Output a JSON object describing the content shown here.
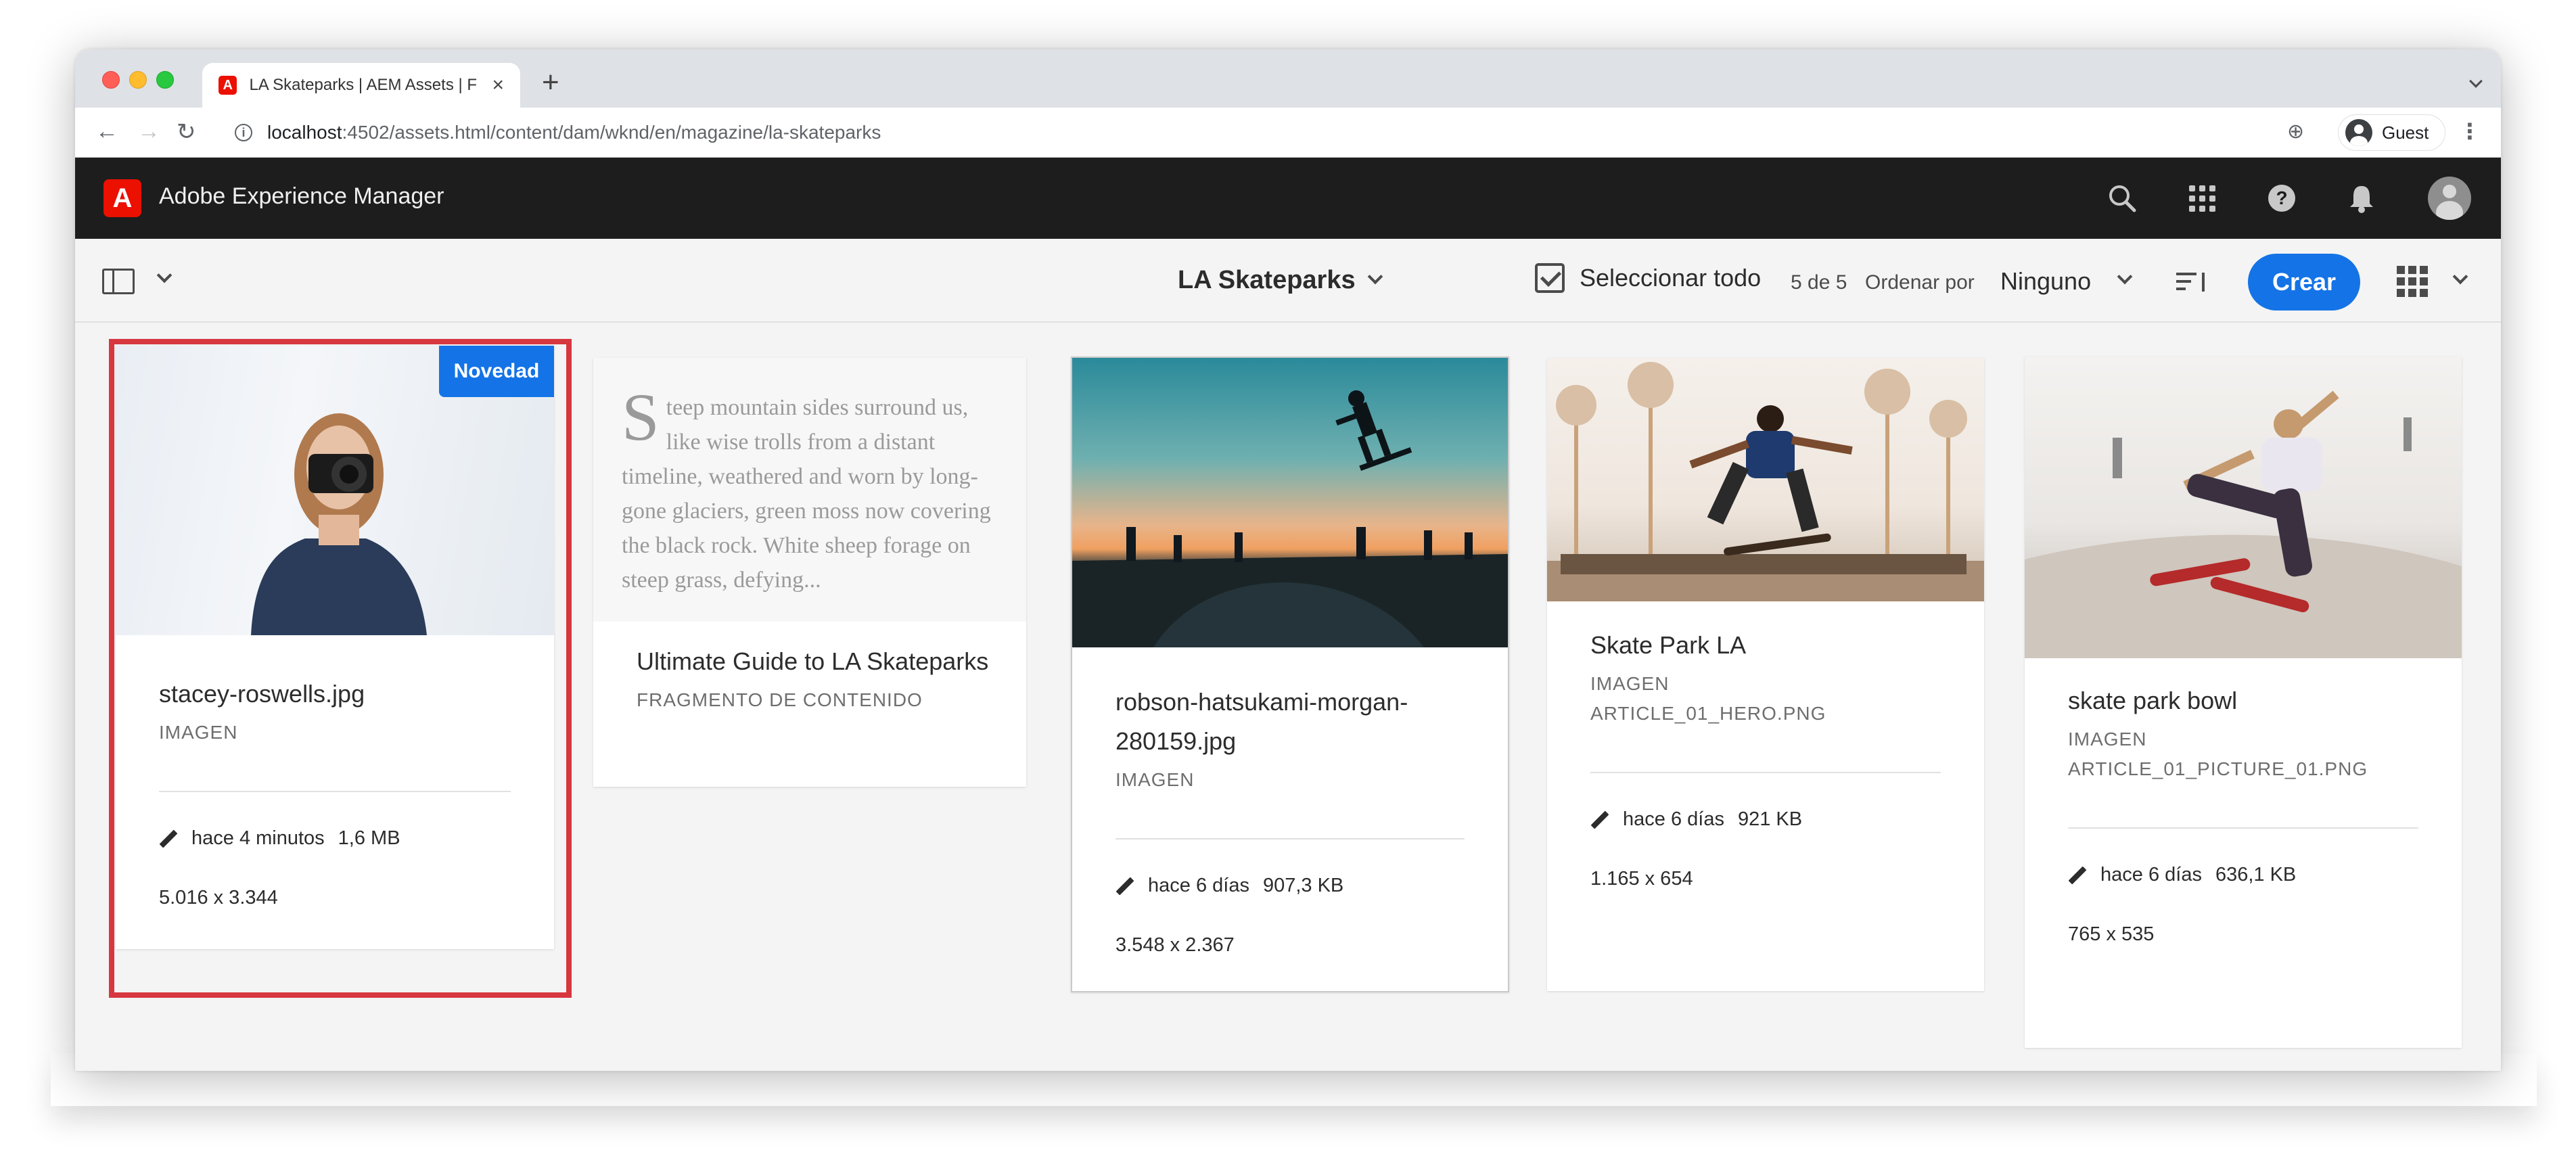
{
  "browser": {
    "tab_title": "LA Skateparks | AEM Assets | F",
    "url_host": "localhost",
    "url_path": ":4502/assets.html/content/dam/wknd/en/magazine/la-skateparks",
    "profile_label": "Guest"
  },
  "shell": {
    "app_title": "Adobe Experience Manager",
    "logo_glyph": "A",
    "icons": [
      "search-icon",
      "apps-icon",
      "help-icon",
      "bell-icon",
      "avatar"
    ]
  },
  "actionbar": {
    "folder_title": "LA Skateparks",
    "select_all_label": "Seleccionar todo",
    "count": "5 de 5",
    "sort_label": "Ordenar por",
    "sort_value": "Ninguno",
    "create_label": "Crear"
  },
  "colors": {
    "accent": "#1473e6",
    "adobe_red": "#eb1000",
    "selection_outline": "#d7373f"
  },
  "cards": [
    {
      "title": "stacey-roswells.jpg",
      "type": "IMAGEN",
      "badge": "Novedad",
      "modified": "hace 4 minutos",
      "size": "1,6 MB",
      "dimensions": "5.016 x 3.344"
    },
    {
      "preview_dropcap": "S",
      "preview_text": "teep mountain sides surround us, like wise trolls from a distant timeline, weathered and worn by long-gone glaciers, green moss now covering the black rock. White sheep forage on steep grass, defying...",
      "title": "Ultimate Guide to LA Skateparks",
      "type": "FRAGMENTO DE CONTENIDO"
    },
    {
      "title_line1": "robson-hatsukami-morgan-",
      "title_line2": "280159.jpg",
      "type": "IMAGEN",
      "modified": "hace 6 días",
      "size": "907,3 KB",
      "dimensions": "3.548 x 2.367"
    },
    {
      "title": "Skate Park LA",
      "type": "IMAGEN",
      "filename": "ARTICLE_01_HERO.PNG",
      "modified": "hace 6 días",
      "size": "921 KB",
      "dimensions": "1.165 x 654"
    },
    {
      "title": "skate park bowl",
      "type": "IMAGEN",
      "filename": "ARTICLE_01_PICTURE_01.PNG",
      "modified": "hace 6 días",
      "size": "636,1 KB",
      "dimensions": "765 x 535"
    }
  ]
}
